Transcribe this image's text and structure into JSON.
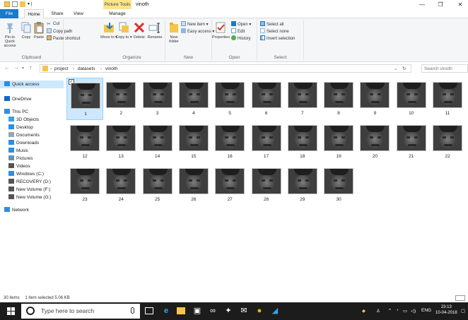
{
  "window": {
    "title": "vinoth",
    "context_tab": "Picture Tools",
    "controls": {
      "minimize": "—",
      "maximize": "❐",
      "close": "✕"
    }
  },
  "ribbon_tabs": [
    "File",
    "Home",
    "Share",
    "View",
    "Manage"
  ],
  "ribbon": {
    "clipboard": {
      "label": "Clipboard",
      "pin": "Pin to Quick access",
      "copy": "Copy",
      "paste": "Paste",
      "cut": "Cut",
      "copy_path": "Copy path",
      "paste_shortcut": "Paste shortcut"
    },
    "organize": {
      "label": "Organize",
      "move_to": "Move to ▾",
      "copy_to": "Copy to ▾",
      "delete": "Delete",
      "rename": "Rename"
    },
    "new": {
      "label": "New",
      "new_folder": "New folder",
      "new_item": "New item ▾",
      "easy_access": "Easy access ▾"
    },
    "open": {
      "label": "Open",
      "properties": "Properties",
      "open": "Open ▾",
      "edit": "Edit",
      "history": "History"
    },
    "select": {
      "label": "Select",
      "select_all": "Select all",
      "select_none": "Select none",
      "invert_selection": "Invert selection"
    }
  },
  "address": {
    "crumbs": [
      "project",
      "datasets",
      "vinoth"
    ],
    "search_placeholder": "Search vinoth"
  },
  "nav": {
    "items": [
      {
        "label": "Quick access",
        "icon": "star-icon",
        "color": "#2f8de4"
      },
      {
        "label": "OneDrive",
        "icon": "cloud-icon",
        "color": "#1266c4"
      },
      {
        "label": "This PC",
        "icon": "monitor-icon",
        "color": "#2f8de4"
      },
      {
        "label": "3D Objects",
        "icon": "cube-icon",
        "color": "#3aa0e8"
      },
      {
        "label": "Desktop",
        "icon": "desktop-icon",
        "color": "#2f8de4"
      },
      {
        "label": "Documents",
        "icon": "document-icon",
        "color": "#9aa4ad"
      },
      {
        "label": "Downloads",
        "icon": "download-icon",
        "color": "#2f8de4"
      },
      {
        "label": "Music",
        "icon": "music-icon",
        "color": "#2f8de4"
      },
      {
        "label": "Pictures",
        "icon": "pictures-icon",
        "color": "#6b8fb1"
      },
      {
        "label": "Videos",
        "icon": "videos-icon",
        "color": "#555555"
      },
      {
        "label": "Windows (C:)",
        "icon": "drive-icon",
        "color": "#2f8de4"
      },
      {
        "label": "RECOVERY (D:)",
        "icon": "drive-icon",
        "color": "#555555"
      },
      {
        "label": "New Volume (F:)",
        "icon": "drive-icon",
        "color": "#555555"
      },
      {
        "label": "New Volume (G:)",
        "icon": "drive-icon",
        "color": "#555555"
      },
      {
        "label": "Network",
        "icon": "network-icon",
        "color": "#2f8de4"
      }
    ]
  },
  "files": [
    "1",
    "2",
    "3",
    "4",
    "5",
    "6",
    "7",
    "8",
    "9",
    "10",
    "11",
    "12",
    "13",
    "14",
    "15",
    "16",
    "17",
    "18",
    "19",
    "20",
    "21",
    "22",
    "23",
    "24",
    "25",
    "26",
    "27",
    "28",
    "29",
    "30"
  ],
  "status": {
    "items": "30 items",
    "selected": "1 item selected  5.06 KB"
  },
  "taskbar": {
    "search_placeholder": "Type here to search",
    "tray_lang": "ENG",
    "time": "23:13",
    "date": "10-04-2018"
  },
  "colors": {
    "accent": "#1979ca",
    "selection": "#cce8ff",
    "context_tab": "#fbe58a",
    "taskbar": "#1c1c1c"
  }
}
